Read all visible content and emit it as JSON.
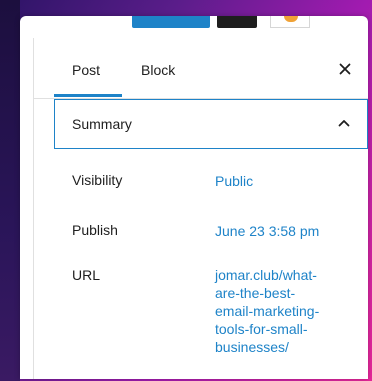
{
  "toolbar": {
    "update_button": "",
    "settings_button": "",
    "avatar": ""
  },
  "sidebar": {
    "tabs": [
      {
        "label": "Post",
        "active": true
      },
      {
        "label": "Block",
        "active": false
      }
    ],
    "close_icon": "close-icon",
    "summary": {
      "title": "Summary",
      "expanded": true,
      "icon": "chevron-up-icon"
    },
    "rows": {
      "visibility": {
        "label": "Visibility",
        "value": "Public"
      },
      "publish": {
        "label": "Publish",
        "value": "June 23 3:58 pm"
      },
      "url": {
        "label": "URL",
        "value_lines": [
          "jomar.club/what-",
          "are-the-best-",
          "email-marketing-",
          "tools-for-small-",
          "businesses/"
        ]
      }
    }
  },
  "colors": {
    "accent": "#1e83c8",
    "text": "#1e1e1e",
    "border": "#e0e0e0",
    "background_gradient_start": "#2d1466",
    "background_gradient_end": "#e8289a"
  }
}
